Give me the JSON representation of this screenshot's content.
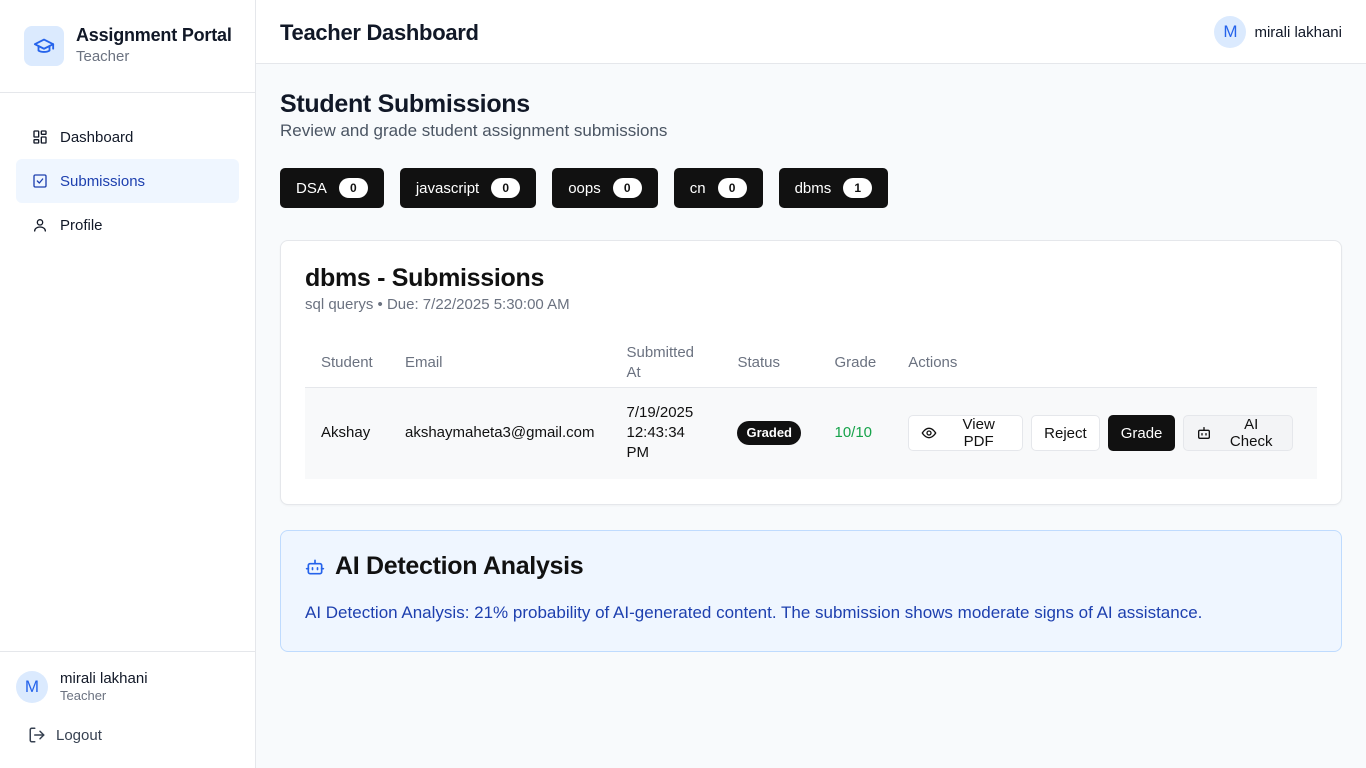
{
  "sidebar": {
    "app_title": "Assignment Portal",
    "app_role": "Teacher",
    "items": [
      {
        "label": "Dashboard",
        "icon": "dashboard-icon"
      },
      {
        "label": "Submissions",
        "icon": "clipboard-check-icon"
      },
      {
        "label": "Profile",
        "icon": "user-icon"
      }
    ],
    "user": {
      "initial": "M",
      "name": "mirali lakhani",
      "role": "Teacher"
    },
    "logout_label": "Logout"
  },
  "header": {
    "title": "Teacher Dashboard",
    "user_initial": "M",
    "user_name": "mirali lakhani"
  },
  "main": {
    "title": "Student Submissions",
    "subtitle": "Review and grade student assignment submissions",
    "subjects": [
      {
        "name": "DSA",
        "count": "0"
      },
      {
        "name": "javascript",
        "count": "0"
      },
      {
        "name": "oops",
        "count": "0"
      },
      {
        "name": "cn",
        "count": "0"
      },
      {
        "name": "dbms",
        "count": "1"
      }
    ],
    "submissions_card": {
      "title": "dbms - Submissions",
      "subtitle": "sql querys • Due: 7/22/2025 5:30:00 AM",
      "columns": [
        "Student",
        "Email",
        "Submitted At",
        "Status",
        "Grade",
        "Actions"
      ],
      "rows": [
        {
          "student": "Akshay",
          "email": "akshaymaheta3@gmail.com",
          "submitted_at": "7/19/2025 12:43:34 PM",
          "status": "Graded",
          "grade": "10/10",
          "actions": {
            "view": "View PDF",
            "reject": "Reject",
            "grade": "Grade",
            "ai": "AI Check"
          }
        }
      ]
    },
    "ai_analysis": {
      "title": "AI Detection Analysis",
      "text": "AI Detection Analysis: 21% probability of AI-generated content. The submission shows moderate signs of AI assistance."
    }
  },
  "colors": {
    "accent": "#2563eb",
    "active_nav_bg": "#eff6ff",
    "grade_green": "#16a34a",
    "ai_box_bg": "#eff6ff"
  }
}
